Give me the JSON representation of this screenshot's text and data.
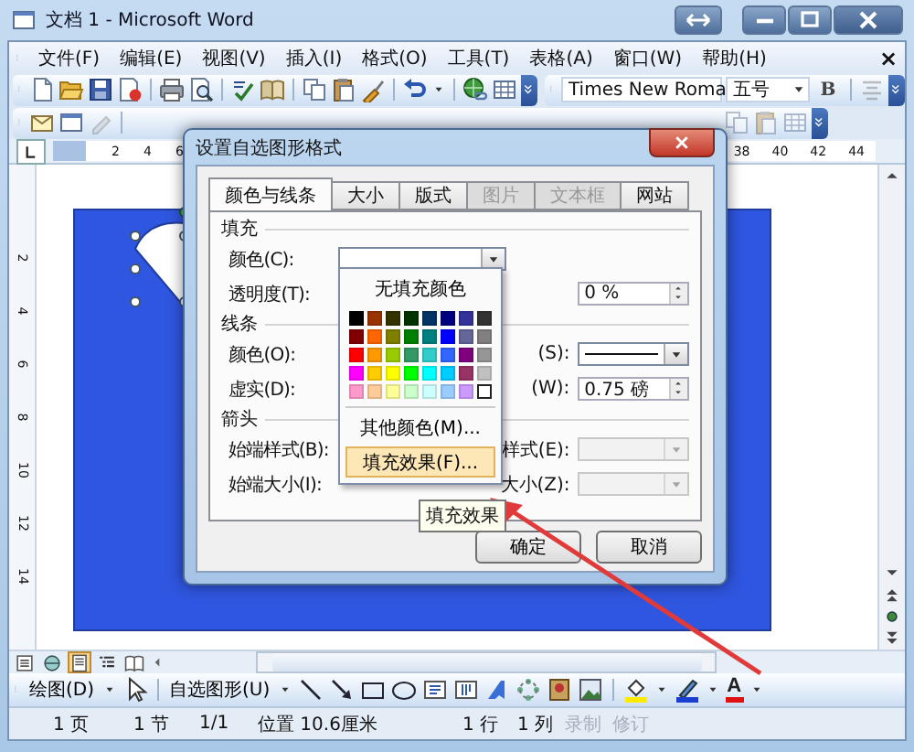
{
  "window": {
    "title": "文档 1 - Microsoft Word"
  },
  "menu": [
    "文件(F)",
    "编辑(E)",
    "视图(V)",
    "插入(I)",
    "格式(O)",
    "工具(T)",
    "表格(A)",
    "窗口(W)",
    "帮助(H)"
  ],
  "menu_close": "×",
  "formatting": {
    "font": "Times New Roma",
    "size": "五号",
    "bold": "B"
  },
  "ruler": {
    "left_numbers": [
      "2",
      "4",
      "6"
    ],
    "right_numbers": [
      "38",
      "40",
      "42",
      "44"
    ],
    "side_numbers": [
      "2",
      "4",
      "6",
      "8",
      "10",
      "12",
      "14"
    ]
  },
  "dialog": {
    "title": "设置自选图形格式",
    "tabs": [
      {
        "label": "颜色与线条",
        "selected": true,
        "disabled": false
      },
      {
        "label": "大小",
        "selected": false,
        "disabled": false
      },
      {
        "label": "版式",
        "selected": false,
        "disabled": false
      },
      {
        "label": "图片",
        "selected": false,
        "disabled": true
      },
      {
        "label": "文本框",
        "selected": false,
        "disabled": true
      },
      {
        "label": "网站",
        "selected": false,
        "disabled": false
      }
    ],
    "sections": [
      {
        "heading": "填充",
        "rows": [
          {
            "label": "颜色(C):",
            "kind": "color-dropdown"
          },
          {
            "label": "透明度(T):",
            "kind": "spin",
            "value": "0 %"
          }
        ]
      },
      {
        "heading": "线条",
        "rows": [
          {
            "label": "颜色(O):",
            "side_label": "(S):",
            "kind": "line-dropdown"
          },
          {
            "label": "虚实(D):",
            "side_label": "(W):",
            "kind": "spin",
            "value": "0.75 磅"
          }
        ]
      },
      {
        "heading": "箭头",
        "rows": [
          {
            "label": "始端样式(B):",
            "side_label": "样式(E):",
            "kind": "disabled-dropdown"
          },
          {
            "label": "始端大小(I):",
            "side_label": "大小(Z):",
            "kind": "disabled-dropdown"
          }
        ]
      }
    ],
    "buttons": [
      "确定",
      "取消"
    ]
  },
  "popup": {
    "no_fill": "无填充颜色",
    "colors": [
      {
        "color": "#000000",
        "selected": false
      },
      {
        "color": "#993300",
        "selected": false
      },
      {
        "color": "#333300",
        "selected": false
      },
      {
        "color": "#003300",
        "selected": false
      },
      {
        "color": "#003366",
        "selected": false
      },
      {
        "color": "#000080",
        "selected": false
      },
      {
        "color": "#333399",
        "selected": false
      },
      {
        "color": "#333333",
        "selected": false
      },
      {
        "color": "#800000",
        "selected": false
      },
      {
        "color": "#ff6600",
        "selected": false
      },
      {
        "color": "#808000",
        "selected": false
      },
      {
        "color": "#008000",
        "selected": false
      },
      {
        "color": "#008080",
        "selected": false
      },
      {
        "color": "#0000ff",
        "selected": false
      },
      {
        "color": "#666699",
        "selected": false
      },
      {
        "color": "#808080",
        "selected": false
      },
      {
        "color": "#ff0000",
        "selected": false
      },
      {
        "color": "#ff9900",
        "selected": false
      },
      {
        "color": "#99cc00",
        "selected": false
      },
      {
        "color": "#339966",
        "selected": false
      },
      {
        "color": "#33cccc",
        "selected": false
      },
      {
        "color": "#3366ff",
        "selected": false
      },
      {
        "color": "#800080",
        "selected": false
      },
      {
        "color": "#969696",
        "selected": false
      },
      {
        "color": "#ff00ff",
        "selected": false
      },
      {
        "color": "#ffcc00",
        "selected": false
      },
      {
        "color": "#ffff00",
        "selected": false
      },
      {
        "color": "#00ff00",
        "selected": false
      },
      {
        "color": "#00ffff",
        "selected": false
      },
      {
        "color": "#00ccff",
        "selected": false
      },
      {
        "color": "#993366",
        "selected": false
      },
      {
        "color": "#c0c0c0",
        "selected": false
      },
      {
        "color": "#ff99cc",
        "selected": false
      },
      {
        "color": "#ffcc99",
        "selected": false
      },
      {
        "color": "#ffff99",
        "selected": false
      },
      {
        "color": "#ccffcc",
        "selected": false
      },
      {
        "color": "#ccffff",
        "selected": false
      },
      {
        "color": "#99ccff",
        "selected": false
      },
      {
        "color": "#cc99ff",
        "selected": false
      },
      {
        "color": "#ffffff",
        "selected": true
      }
    ],
    "more": "其他颜色(M)...",
    "effects": {
      "label": "填充效果(F)...",
      "selected": true
    },
    "tooltip": "填充效果"
  },
  "view_buttons": [
    {
      "kind": "normal",
      "selected": false
    },
    {
      "kind": "web",
      "selected": false
    },
    {
      "kind": "print",
      "selected": true
    },
    {
      "kind": "outline",
      "selected": false
    },
    {
      "kind": "reading",
      "selected": false
    }
  ],
  "drawing": {
    "draw_menu": "绘图(D)",
    "autoshapes": "自选图形(U)",
    "font_color": "A"
  },
  "status": [
    {
      "text": "1 页",
      "disabled": false
    },
    {
      "text": "1 节",
      "disabled": false
    },
    {
      "text": "1/1",
      "disabled": false
    },
    {
      "text": "位置 10.6厘米",
      "disabled": false
    },
    {
      "text": "1 行",
      "disabled": false
    },
    {
      "text": "1 列",
      "disabled": false
    },
    {
      "text": "录制",
      "disabled": true
    },
    {
      "text": "修订",
      "disabled": true
    }
  ]
}
